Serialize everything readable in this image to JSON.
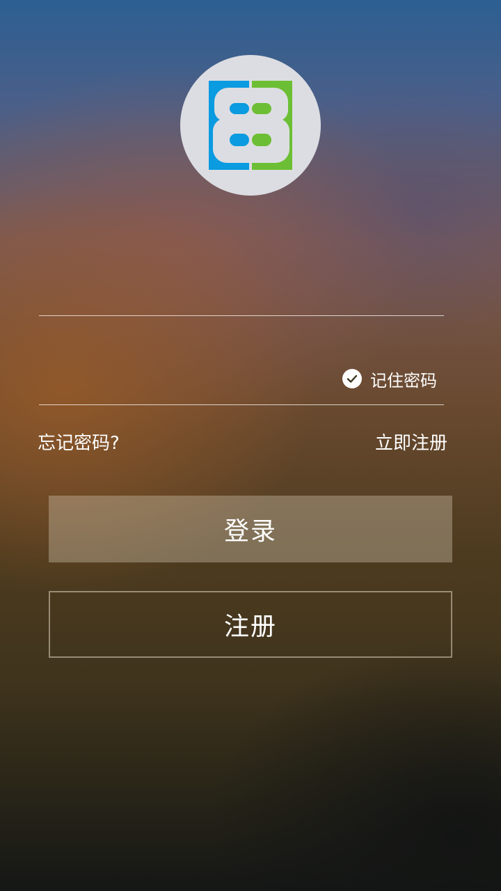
{
  "logo": {
    "icon": "bb-logo-icon",
    "colors": {
      "left": "#0a9be0",
      "right": "#6cbf34",
      "circle": "#dcdde2",
      "inner": "#dcdde2"
    }
  },
  "form": {
    "account_value": "",
    "password_value": "",
    "remember_label": "记住密码",
    "remember_checked": true,
    "remember_icon": "check-circle-icon"
  },
  "links": {
    "forgot": "忘记密码?",
    "register_now": "立即注册"
  },
  "buttons": {
    "login": "登录",
    "signup": "注册"
  }
}
